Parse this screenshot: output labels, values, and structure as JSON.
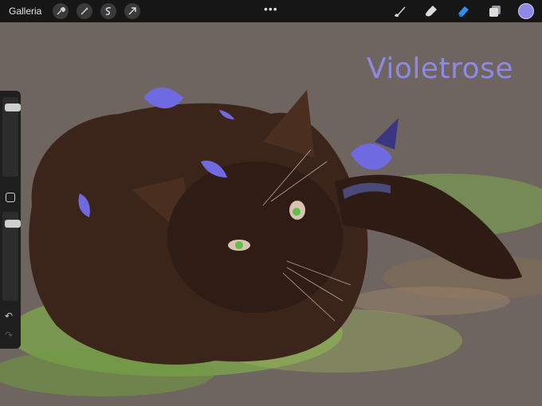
{
  "toolbar": {
    "gallery_label": "Galleria",
    "left_tools": [
      "wrench-icon",
      "magic-wand-icon",
      "selection-icon",
      "transform-icon"
    ],
    "more_label": "•••",
    "right_tools": [
      "brush-icon",
      "smudge-icon",
      "eraser-icon",
      "layers-icon"
    ],
    "current_color": "#8e88e8"
  },
  "canvas": {
    "signature": "Violetrose",
    "colors": {
      "background": "#6e6460",
      "fur": "#3b2419",
      "grass": "#7fb04a",
      "flowers": "#6f6ae0",
      "eyes": "#5fbf4a"
    }
  },
  "sidebar": {
    "brush_size_level": 0.92,
    "opacity_level": 0.88
  }
}
